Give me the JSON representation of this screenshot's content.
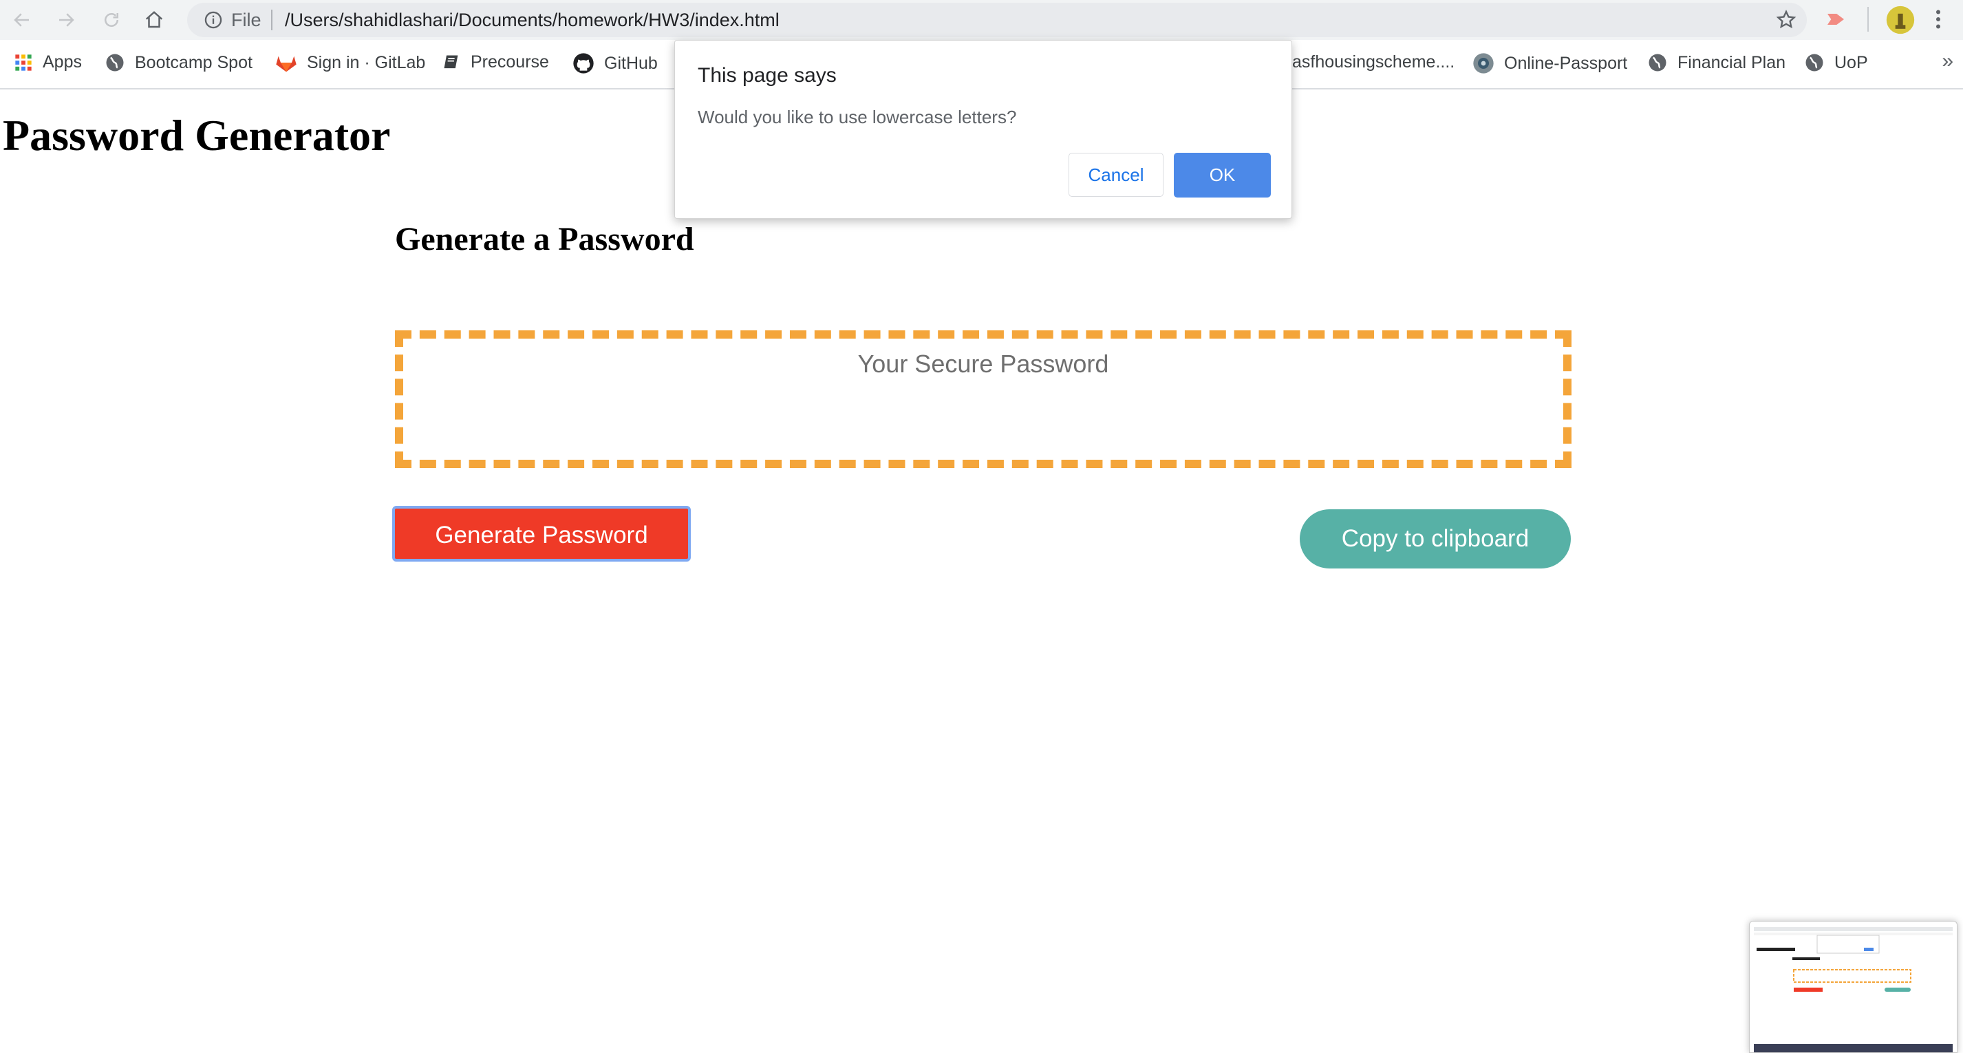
{
  "browser": {
    "omnibox": {
      "scheme_label": "File",
      "url": "/Users/shahidlashari/Documents/homework/HW3/index.html"
    },
    "bookmarks": [
      {
        "label": "Apps",
        "icon": "apps-grid-icon"
      },
      {
        "label": "Bootcamp Spot",
        "icon": "globe-icon"
      },
      {
        "label": "Sign in · GitLab",
        "icon": "gitlab-icon"
      },
      {
        "label": "Precourse",
        "icon": "book-icon"
      },
      {
        "label": "GitHub",
        "icon": "github-icon"
      },
      {
        "label": "asfhousingscheme....",
        "icon": "none"
      },
      {
        "label": "Online-Passport",
        "icon": "passport-icon"
      },
      {
        "label": "Financial Plan",
        "icon": "globe-icon"
      },
      {
        "label": "UoP",
        "icon": "globe-icon"
      }
    ],
    "more_label": "»"
  },
  "page": {
    "title": "Password Generator",
    "card_title": "Generate a Password",
    "password_placeholder": "Your Secure Password",
    "generate_label": "Generate Password",
    "copy_label": "Copy to clipboard"
  },
  "dialog": {
    "title": "This page says",
    "message": "Would you like to use lowercase letters?",
    "cancel_label": "Cancel",
    "ok_label": "OK"
  },
  "colors": {
    "generate_button": "#ef3a27",
    "copy_button": "#57b1a6",
    "password_border": "#f4a53a",
    "ok_button": "#4c89e8"
  }
}
